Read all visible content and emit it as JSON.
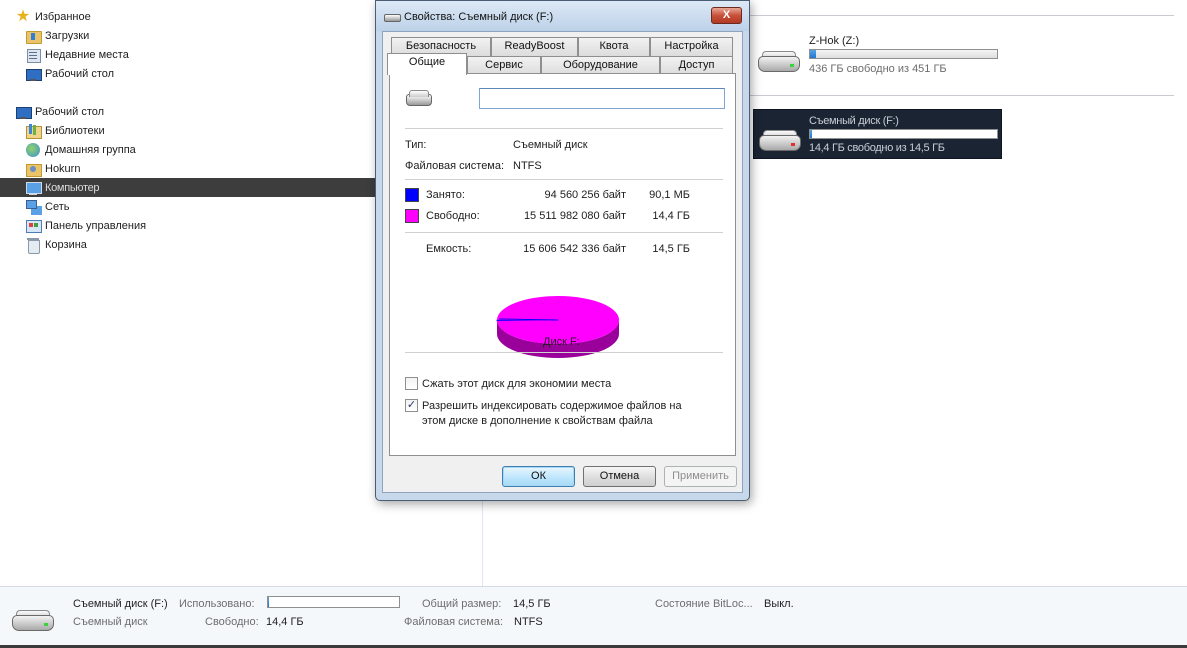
{
  "nav": {
    "favorites": {
      "label": "Избранное",
      "items": [
        {
          "label": "Загрузки",
          "icon": "downloads-folder-icon"
        },
        {
          "label": "Недавние места",
          "icon": "recent-places-icon"
        },
        {
          "label": "Рабочий стол",
          "icon": "desktop-icon"
        }
      ]
    },
    "desktop": {
      "label": "Рабочий стол",
      "items": [
        {
          "label": "Библиотеки",
          "icon": "libraries-icon"
        },
        {
          "label": "Домашняя группа",
          "icon": "homegroup-icon"
        },
        {
          "label": "Hokurn",
          "icon": "user-folder-icon"
        },
        {
          "label": "Компьютер",
          "icon": "computer-icon",
          "selected": true
        },
        {
          "label": "Сеть",
          "icon": "network-icon"
        },
        {
          "label": "Панель управления",
          "icon": "control-panel-icon"
        },
        {
          "label": "Корзина",
          "icon": "recycle-bin-icon"
        }
      ]
    }
  },
  "drives": [
    {
      "title": "Z-Hok (Z:)",
      "free_text": "436 ГБ свободно из 451 ГБ",
      "used_fraction": 0.03
    },
    {
      "title": "Съемный диск (F:)",
      "free_text": "14,4 ГБ свободно из 14,5 ГБ",
      "used_fraction": 0.01,
      "selected": true
    }
  ],
  "details": {
    "name": "Съемный диск (F:)",
    "type": "Съемный диск",
    "used_label": "Использовано:",
    "used_fraction": 0.01,
    "free_label": "Свободно:",
    "free_value": "14,4 ГБ",
    "total_label": "Общий размер:",
    "total_value": "14,5 ГБ",
    "fs_label": "Файловая система:",
    "fs_value": "NTFS",
    "bitlocker_label": "Состояние BitLoc...",
    "bitlocker_value": "Выкл."
  },
  "dialog": {
    "title": "Свойства: Съемный диск (F:)",
    "close_label": "X",
    "tabs_row1": [
      "Безопасность",
      "ReadyBoost",
      "Квота",
      "Настройка"
    ],
    "tabs_row2": [
      "Общие",
      "Сервис",
      "Оборудование",
      "Доступ"
    ],
    "active_tab": "Общие",
    "volume_name": "",
    "type_label": "Тип:",
    "type_value": "Съемный диск",
    "fs_label": "Файловая система:",
    "fs_value": "NTFS",
    "used": {
      "label": "Занято:",
      "bytes": "94 560 256 байт",
      "size": "90,1 МБ",
      "color": "#0000ff"
    },
    "free": {
      "label": "Свободно:",
      "bytes": "15 511 982 080 байт",
      "size": "14,4 ГБ",
      "color": "#ff00ff"
    },
    "capacity": {
      "label": "Емкость:",
      "bytes": "15 606 542 336 байт",
      "size": "14,5 ГБ"
    },
    "disk_label": "Диск F:",
    "compress_label": "Сжать этот диск для экономии места",
    "compress_checked": false,
    "index_label_line1": "Разрешить индексировать содержимое файлов на",
    "index_label_line2": "этом диске в дополнение к свойствам файла",
    "index_checked": true,
    "ok_label": "ОК",
    "cancel_label": "Отмена",
    "apply_label": "Применить"
  },
  "chart_data": {
    "type": "pie",
    "title": "Диск F:",
    "categories": [
      "Занято:",
      "Свободно:"
    ],
    "values": [
      94560256,
      15511982080
    ],
    "colors": [
      "#0000ff",
      "#ff00ff"
    ]
  }
}
